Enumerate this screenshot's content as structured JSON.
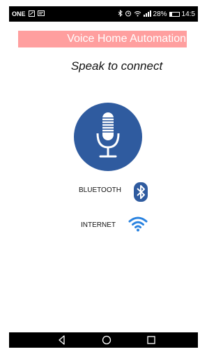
{
  "status_bar": {
    "carrier": "ONE",
    "battery_text": "28%",
    "battery_level": 0.28,
    "time": "14:5",
    "icons": [
      "sim-icon",
      "message-icon",
      "bluetooth-icon",
      "alarm-icon",
      "wifi-icon",
      "signal-icon",
      "battery-icon"
    ]
  },
  "app": {
    "title": "Voice Home Automation",
    "subtitle": "Speak to connect",
    "mic_icon": "microphone-icon",
    "connections": [
      {
        "label": "BLUETOOTH",
        "icon": "bluetooth-icon"
      },
      {
        "label": "INTERNET",
        "icon": "wifi-icon"
      }
    ]
  },
  "nav_bar": {
    "icons": [
      "back-icon",
      "home-icon",
      "recents-icon"
    ]
  },
  "colors": {
    "title_bar": "#ff9f9f",
    "mic_circle": "#2f5b9f",
    "bluetooth_badge": "#2f5b9f",
    "wifi": "#2a83e0"
  }
}
